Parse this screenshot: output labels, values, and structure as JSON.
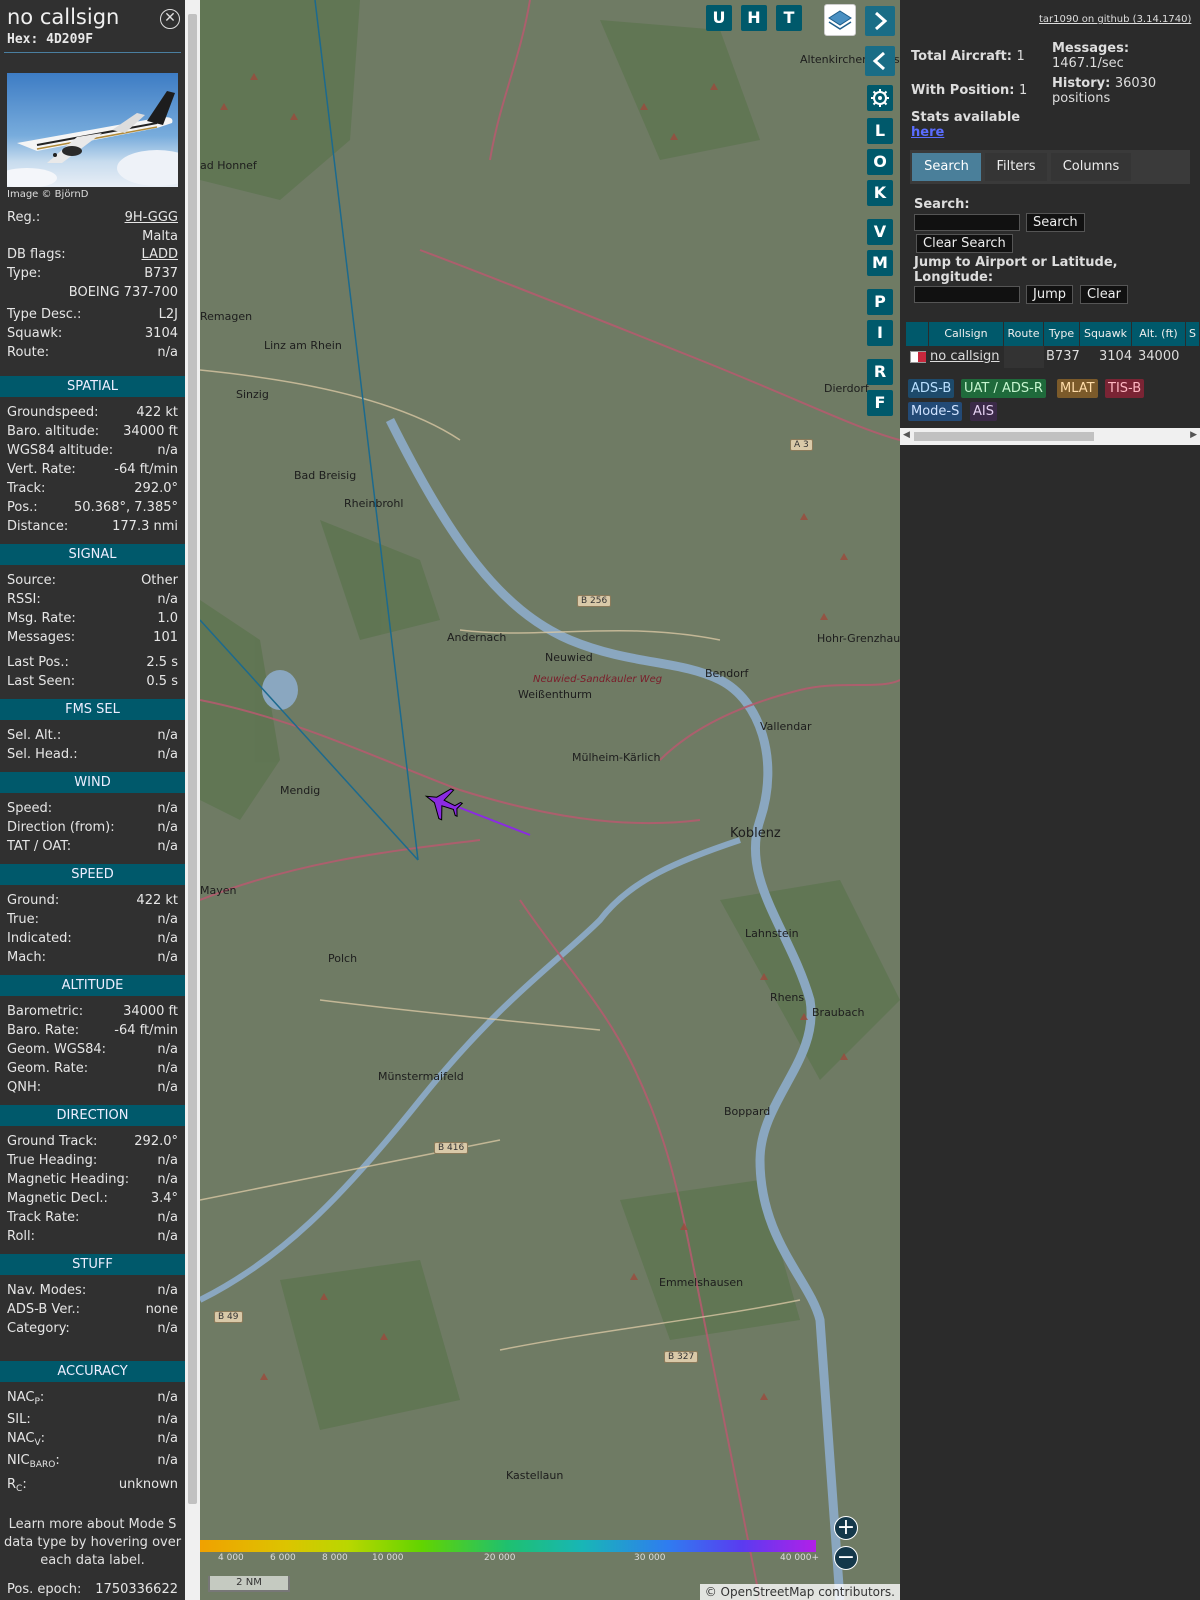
{
  "info": {
    "callsign": "no callsign",
    "hex": "Hex: 4D209F",
    "image_credit": "Image © BjörnD",
    "close_glyph": "✕",
    "top_rows": [
      {
        "k": "Reg.:",
        "v": "9H-GGG",
        "link": true
      },
      {
        "k": "",
        "v": "Malta"
      },
      {
        "k": "DB flags:",
        "v": "LADD",
        "link": true
      },
      {
        "k": "Type:",
        "v": "B737"
      },
      {
        "k": "",
        "v": "BOEING 737-700"
      },
      {
        "k": "Type Desc.:",
        "v": "L2J"
      },
      {
        "k": "Squawk:",
        "v": "3104"
      },
      {
        "k": "Route:",
        "v": "n/a"
      }
    ],
    "sections": {
      "spatial": "SPATIAL",
      "signal": "SIGNAL",
      "fms": "FMS SEL",
      "wind": "WIND",
      "speed": "SPEED",
      "altitude": "ALTITUDE",
      "direction": "DIRECTION",
      "stuff": "STUFF",
      "accuracy": "ACCURACY"
    },
    "spatial": [
      {
        "k": "Groundspeed:",
        "v": "422 kt"
      },
      {
        "k": "Baro. altitude:",
        "v": "34000 ft"
      },
      {
        "k": "WGS84 altitude:",
        "v": "n/a"
      },
      {
        "k": "Vert. Rate:",
        "v": "-64 ft/min"
      },
      {
        "k": "Track:",
        "v": "292.0°"
      },
      {
        "k": "Pos.:",
        "v": "50.368°, 7.385°"
      },
      {
        "k": "Distance:",
        "v": "177.3 nmi"
      }
    ],
    "signal": [
      {
        "k": "Source:",
        "v": "Other"
      },
      {
        "k": "RSSI:",
        "v": "n/a"
      },
      {
        "k": "Msg. Rate:",
        "v": "1.0"
      },
      {
        "k": "Messages:",
        "v": "101"
      },
      {
        "k": "Last Pos.:",
        "v": "2.5 s"
      },
      {
        "k": "Last Seen:",
        "v": "0.5 s"
      }
    ],
    "fms": [
      {
        "k": "Sel. Alt.:",
        "v": "n/a"
      },
      {
        "k": "Sel. Head.:",
        "v": "n/a"
      }
    ],
    "wind": [
      {
        "k": "Speed:",
        "v": "n/a"
      },
      {
        "k": "Direction (from):",
        "v": "n/a"
      },
      {
        "k": "TAT / OAT:",
        "v": "n/a"
      }
    ],
    "speed": [
      {
        "k": "Ground:",
        "v": "422 kt"
      },
      {
        "k": "True:",
        "v": "n/a"
      },
      {
        "k": "Indicated:",
        "v": "n/a"
      },
      {
        "k": "Mach:",
        "v": "n/a"
      }
    ],
    "altitude": [
      {
        "k": "Barometric:",
        "v": "34000 ft"
      },
      {
        "k": "Baro. Rate:",
        "v": "-64 ft/min"
      },
      {
        "k": "Geom. WGS84:",
        "v": "n/a"
      },
      {
        "k": "Geom. Rate:",
        "v": "n/a"
      },
      {
        "k": "QNH:",
        "v": "n/a"
      }
    ],
    "direction": [
      {
        "k": "Ground Track:",
        "v": "292.0°"
      },
      {
        "k": "True Heading:",
        "v": "n/a"
      },
      {
        "k": "Magnetic Heading:",
        "v": "n/a"
      },
      {
        "k": "Magnetic Decl.:",
        "v": "3.4°"
      },
      {
        "k": "Track Rate:",
        "v": "n/a"
      },
      {
        "k": "Roll:",
        "v": "n/a"
      }
    ],
    "stuff": [
      {
        "k": "Nav. Modes:",
        "v": "n/a"
      },
      {
        "k": "ADS-B Ver.:",
        "v": "none"
      },
      {
        "k": "Category:",
        "v": "n/a"
      }
    ],
    "accuracy": {
      "nacp_k": "NAC",
      "nacp_sub": "P",
      "nacp_v": "n/a",
      "sil_k": "SIL:",
      "sil_v": "n/a",
      "nacv_k": "NAC",
      "nacv_sub": "V",
      "nacv_v": "n/a",
      "nic_k": "NIC",
      "nic_sub": "BARO",
      "nic_v": "n/a",
      "rc_k": "R",
      "rc_sub": "C",
      "rc_v": "unknown"
    },
    "learn_more": "Learn more about Mode S data type by hovering over each data label.",
    "pos_epoch_k": "Pos. epoch:",
    "pos_epoch_v": "1750336622"
  },
  "map": {
    "places": [
      {
        "name": "Altenkirchen (Westerwald)"
      },
      {
        "name": "ad Honnef"
      },
      {
        "name": "Remagen"
      },
      {
        "name": "Linz am Rhein"
      },
      {
        "name": "Sinzig"
      },
      {
        "name": "Dierdorf"
      },
      {
        "name": "Bad Breisig"
      },
      {
        "name": "Rheinbrohl"
      },
      {
        "name": "Andernach"
      },
      {
        "name": "Neuwied"
      },
      {
        "name": "Neuwied-Sandkauler Weg"
      },
      {
        "name": "Weißenthurm"
      },
      {
        "name": "Bendorf"
      },
      {
        "name": "Hohr-Grenzhaus"
      },
      {
        "name": "Vallendar"
      },
      {
        "name": "Mülheim-Kärlich"
      },
      {
        "name": "Mendig"
      },
      {
        "name": "Koblenz"
      },
      {
        "name": "Mayen"
      },
      {
        "name": "Lahnstein"
      },
      {
        "name": "Polch"
      },
      {
        "name": "Rhens"
      },
      {
        "name": "Braubach"
      },
      {
        "name": "Münstermaifeld"
      },
      {
        "name": "Boppard"
      },
      {
        "name": "Emmelshausen"
      },
      {
        "name": "Kastellaun"
      }
    ],
    "roads": [
      "A 3",
      "B 256",
      "B 416",
      "B 49",
      "B 327"
    ],
    "buttons_top": [
      "U",
      "H",
      "T"
    ],
    "buttons_side": [
      "L",
      "O",
      "K",
      "V",
      "M",
      "P",
      "I",
      "R",
      "F"
    ],
    "alt_labels": [
      "4 000",
      "6 000",
      "8 000",
      "10 000",
      "20 000",
      "30 000",
      "40 000+"
    ],
    "scale": "2 NM",
    "attribution": "© OpenStreetMap contributors."
  },
  "sidebar": {
    "github": "tar1090 on github (3.14.1740)",
    "total_aircraft_k": "Total Aircraft:",
    "total_aircraft_v": "1",
    "with_position_k": "With Position:",
    "with_position_v": "1",
    "messages_k": "Messages:",
    "messages_v": "1467.1/sec",
    "history_k": "History:",
    "history_v": "36030 positions",
    "stats_available": "Stats available",
    "stats_here": "here",
    "tabs": [
      "Search",
      "Filters",
      "Columns"
    ],
    "search_label": "Search:",
    "search_button": "Search",
    "clear_search_button": "Clear Search",
    "jump_label": "Jump to Airport or Latitude, Longitude:",
    "jump_button": "Jump",
    "clear_button": "Clear",
    "columns": [
      "Callsign",
      "Route",
      "Type",
      "Squawk",
      "Alt. (ft)",
      "S"
    ],
    "row": {
      "callsign": "no callsign",
      "route": "",
      "type": "B737",
      "squawk": "3104",
      "alt": "34000"
    },
    "badges": [
      {
        "label": "ADS-B",
        "bg": "#1d4a6b",
        "fg": "#b9e0ff"
      },
      {
        "label": "UAT / ADS-R",
        "bg": "#1f6a3b",
        "fg": "#c6f5cf"
      },
      {
        "label": "MLAT",
        "bg": "#7b5a2a",
        "fg": "#ffdca8"
      },
      {
        "label": "TIS-B",
        "bg": "#7a2434",
        "fg": "#ffb7c2"
      },
      {
        "label": "Mode-S",
        "bg": "#234a76",
        "fg": "#cfe2ff"
      },
      {
        "label": "AIS",
        "bg": "#3b2a48",
        "fg": "#e6d2f3"
      }
    ]
  }
}
